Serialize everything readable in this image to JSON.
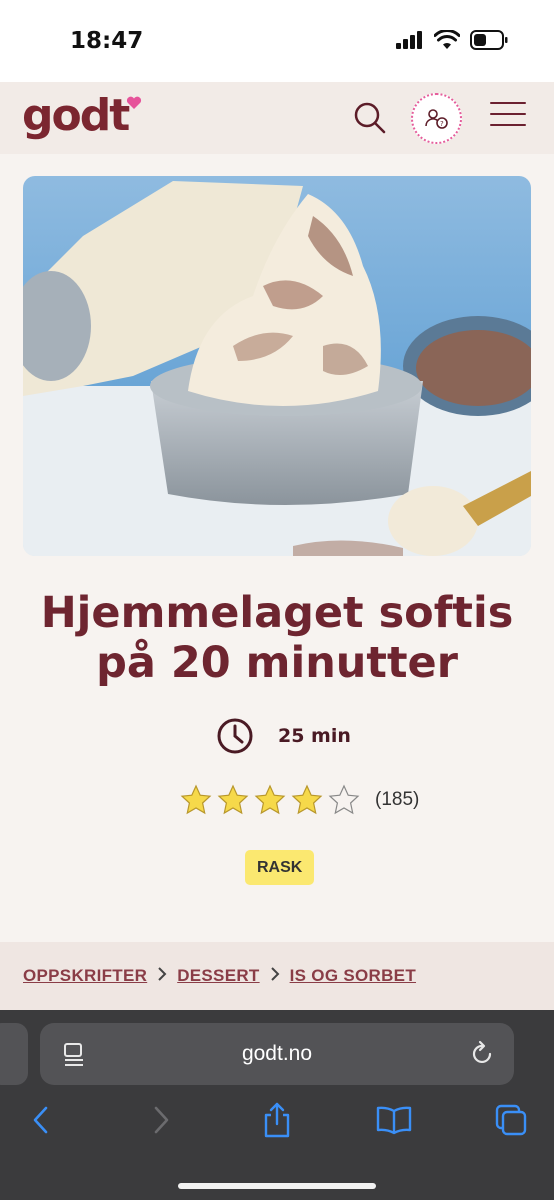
{
  "status_bar": {
    "time": "18:47"
  },
  "header": {
    "logo_text": "godt",
    "search_icon": "search-icon",
    "profile_icon": "profile-icon",
    "menu_icon": "hamburger-menu-icon"
  },
  "recipe": {
    "title": "Hjemmelaget softis på 20 minutter",
    "time": "25 min",
    "rating": 4,
    "rating_max": 5,
    "rating_count": "(185)",
    "tag": "RASK"
  },
  "breadcrumb": [
    "OPPSKRIFTER",
    "DESSERT",
    "IS OG SORBET"
  ],
  "browser": {
    "url": "godt.no",
    "toolbar_icons": [
      "back-icon",
      "forward-icon",
      "share-icon",
      "bookmarks-icon",
      "tabs-icon"
    ]
  },
  "colors": {
    "brand": "#7b2630",
    "accent_pink": "#e6539a",
    "tag_bg": "#fbe870",
    "star": "#f6d94a",
    "safari_blue": "#3a8ff7"
  }
}
